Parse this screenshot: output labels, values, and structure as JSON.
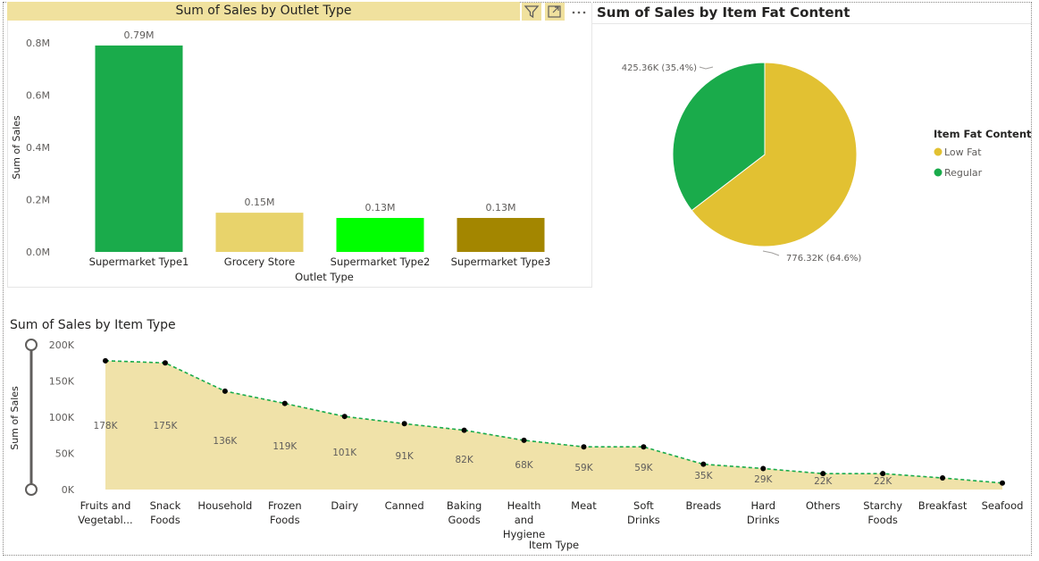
{
  "header_icons": [
    "filter-icon",
    "focus-mode-icon",
    "more-options-icon"
  ],
  "colors": {
    "title_bar": "#f0e19e",
    "area_fill": "#f0e2a9",
    "area_line": "#1aab4b",
    "low_fat": "#e2c132",
    "regular": "#1aab4b"
  },
  "chart_data": [
    {
      "type": "bar",
      "title": "Sum of Sales by Outlet Type",
      "xlabel": "Outlet Type",
      "ylabel": "Sum of Sales",
      "categories": [
        "Supermarket Type1",
        "Grocery Store",
        "Supermarket Type2",
        "Supermarket Type3"
      ],
      "values": [
        0.79,
        0.15,
        0.13,
        0.13
      ],
      "data_labels": [
        "0.79M",
        "0.15M",
        "0.13M",
        "0.13M"
      ],
      "bar_colors": [
        "#1aab4b",
        "#e8d36b",
        "#00ff00",
        "#a38600"
      ],
      "ylim": [
        0,
        0.8
      ],
      "yticks": [
        0,
        0.2,
        0.4,
        0.6,
        0.8
      ],
      "ytick_labels": [
        "0.0M",
        "0.2M",
        "0.4M",
        "0.6M",
        "0.8M"
      ]
    },
    {
      "type": "pie",
      "title": "Sum of Sales by Item Fat Content",
      "legend_title": "Item Fat Content",
      "legend_position": "right",
      "slices": [
        {
          "name": "Low Fat",
          "value": 776.32,
          "label": "776.32K (64.6%)",
          "color": "#e2c132"
        },
        {
          "name": "Regular",
          "value": 425.36,
          "label": "425.36K (35.4%)",
          "color": "#1aab4b"
        }
      ]
    },
    {
      "type": "area",
      "title": "Sum of Sales by Item Type",
      "xlabel": "Item Type",
      "ylabel": "Sum of Sales",
      "categories": [
        "Fruits and Vegetabl...",
        "Snack Foods",
        "Household",
        "Frozen Foods",
        "Dairy",
        "Canned",
        "Baking Goods",
        "Health and Hygiene",
        "Meat",
        "Soft Drinks",
        "Breads",
        "Hard Drinks",
        "Others",
        "Starchy Foods",
        "Breakfast",
        "Seafood"
      ],
      "category_lines": [
        [
          "Fruits and",
          "Vegetabl..."
        ],
        [
          "Snack",
          "Foods"
        ],
        [
          "Household"
        ],
        [
          "Frozen",
          "Foods"
        ],
        [
          "Dairy"
        ],
        [
          "Canned"
        ],
        [
          "Baking",
          "Goods"
        ],
        [
          "Health",
          "and",
          "Hygiene"
        ],
        [
          "Meat"
        ],
        [
          "Soft",
          "Drinks"
        ],
        [
          "Breads"
        ],
        [
          "Hard",
          "Drinks"
        ],
        [
          "Others"
        ],
        [
          "Starchy",
          "Foods"
        ],
        [
          "Breakfast"
        ],
        [
          "Seafood"
        ]
      ],
      "values": [
        178,
        175,
        136,
        119,
        101,
        91,
        82,
        68,
        59,
        59,
        35,
        29,
        22,
        22,
        16,
        9
      ],
      "data_labels": [
        "178K",
        "175K",
        "136K",
        "119K",
        "101K",
        "91K",
        "82K",
        "68K",
        "59K",
        "59K",
        "35K",
        "29K",
        "22K",
        "22K",
        "",
        ""
      ],
      "ylim": [
        0,
        200
      ],
      "yticks": [
        0,
        50,
        100,
        150,
        200
      ],
      "ytick_labels": [
        "0K",
        "50K",
        "100K",
        "150K",
        "200K"
      ]
    }
  ]
}
